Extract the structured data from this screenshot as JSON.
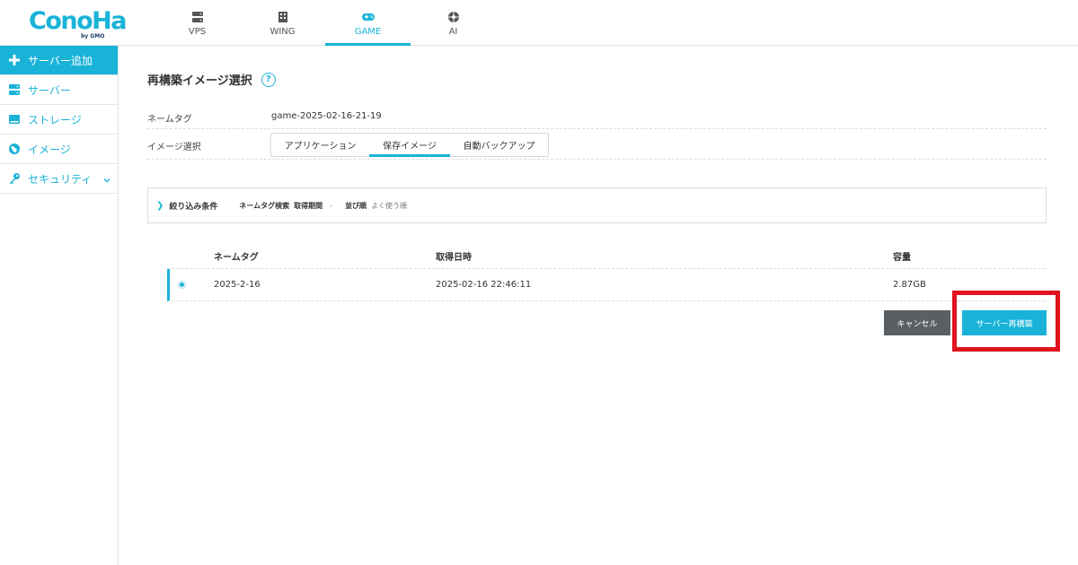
{
  "header": {
    "logo_text": "ConoHa",
    "logo_sub": "by GMO",
    "nav": [
      {
        "label": "VPS",
        "icon": "server-icon"
      },
      {
        "label": "WING",
        "icon": "building-icon"
      },
      {
        "label": "GAME",
        "icon": "gamepad-icon",
        "active": true
      },
      {
        "label": "AI",
        "icon": "ai-icon"
      }
    ]
  },
  "sidebar": {
    "items": [
      {
        "label": "サーバー追加",
        "icon": "plus-icon"
      },
      {
        "label": "サーバー",
        "icon": "server-icon"
      },
      {
        "label": "ストレージ",
        "icon": "storage-icon"
      },
      {
        "label": "イメージ",
        "icon": "globe-icon"
      },
      {
        "label": "セキュリティ",
        "icon": "key-icon"
      }
    ]
  },
  "page": {
    "title": "再構築イメージ選択",
    "help": "?"
  },
  "form": {
    "nametag_label": "ネームタグ",
    "nametag_value": "game-2025-02-16-21-19",
    "image_label": "イメージ選択",
    "tabs": [
      "アプリケーション",
      "保存イメージ",
      "自動バックアップ"
    ],
    "active_tab": "保存イメージ"
  },
  "filter": {
    "title": "絞り込み条件",
    "nametag_search": "ネームタグ検索",
    "period_label": "取得期間",
    "period_value": "-",
    "sort_label": "並び順",
    "sort_value": "よく使う順"
  },
  "table": {
    "headers": [
      "ネームタグ",
      "取得日時",
      "容量"
    ],
    "rows": [
      {
        "nametag": "2025-2-16",
        "date": "2025-02-16 22:46:11",
        "size": "2.87GB",
        "selected": true
      }
    ]
  },
  "buttons": {
    "cancel": "キャンセル",
    "rebuild": "サーバー再構築"
  },
  "colors": {
    "accent": "#1ab3d8",
    "highlight": "#e0141e",
    "cancel_bg": "#5a5f63"
  }
}
